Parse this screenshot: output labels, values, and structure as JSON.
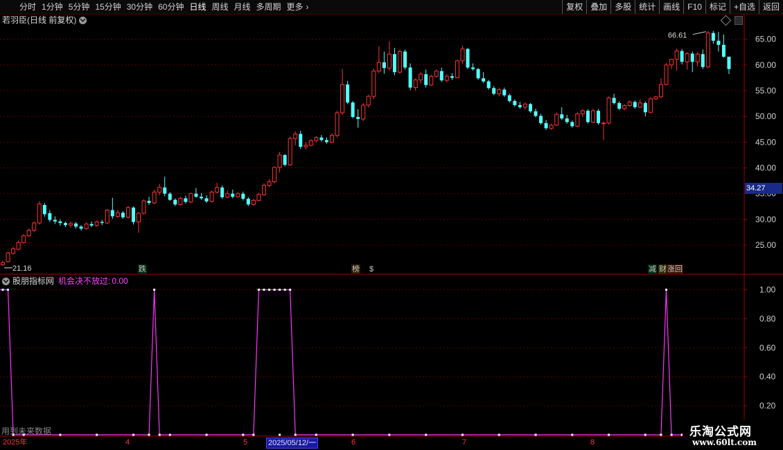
{
  "toolbar": {
    "periods": [
      "分时",
      "1分钟",
      "5分钟",
      "15分钟",
      "30分钟",
      "60分钟",
      "日线",
      "周线",
      "月线",
      "多周期",
      "更多"
    ],
    "active_period": "日线",
    "buttons": [
      "复权",
      "叠加",
      "多股",
      "统计",
      "画线",
      "F10",
      "标记",
      "+自选",
      "返回"
    ]
  },
  "main_panel": {
    "title": "若羽臣(日线 前复权)",
    "current_price_label": "34.27",
    "high_annotation": "66.61",
    "low_annotation": "21.16",
    "y_ticks": [
      "65.00",
      "60.00",
      "55.00",
      "50.00",
      "45.00",
      "40.00",
      "35.00",
      "30.00",
      "25.00"
    ],
    "signals": [
      {
        "text": "跌",
        "color": "#00d060"
      },
      {
        "text": "榜",
        "color": "#e0a000"
      },
      {
        "text": "$",
        "color": "#ff3030"
      },
      {
        "text": "减",
        "color": "#00d060"
      },
      {
        "text": "财",
        "color": "#e0e000"
      },
      {
        "text": "涨回",
        "color": "#ff4040"
      }
    ]
  },
  "sub_panel": {
    "source": "股朋指标网",
    "indicator": "机会决不放过:",
    "value": "0.00",
    "y_ticks": [
      "1.00",
      "0.80",
      "0.60",
      "0.40",
      "0.20"
    ]
  },
  "footnote": "用到未来数据",
  "date_axis": {
    "labels": [
      "2025年",
      "4",
      "5",
      "6",
      "7",
      "8"
    ],
    "selected": "2025/05/12/一"
  },
  "watermark": {
    "title": "乐淘公式网",
    "url": "www.60lt.com"
  },
  "chart_data": {
    "type": "candlestick",
    "up_color": "#ff3333",
    "down_color": "#54ffff",
    "ylim": [
      19.5,
      67.5
    ],
    "candles": [
      [
        21.2,
        22.0,
        21.0,
        21.6
      ],
      [
        21.8,
        23.7,
        21.6,
        23.5
      ],
      [
        23.4,
        24.7,
        23.2,
        24.3
      ],
      [
        24.2,
        25.9,
        24.0,
        25.5
      ],
      [
        25.5,
        27.1,
        25.3,
        26.8
      ],
      [
        26.8,
        28.2,
        26.6,
        27.9
      ],
      [
        27.9,
        29.6,
        27.5,
        29.3
      ],
      [
        29.3,
        33.5,
        29.0,
        33.0
      ],
      [
        32.8,
        33.2,
        30.5,
        31.0
      ],
      [
        31.2,
        31.8,
        29.5,
        29.9
      ],
      [
        29.9,
        30.6,
        29.1,
        29.6
      ],
      [
        29.6,
        30.0,
        28.8,
        29.3
      ],
      [
        29.3,
        29.6,
        28.5,
        28.9
      ],
      [
        28.9,
        29.6,
        28.4,
        29.2
      ],
      [
        29.2,
        29.5,
        28.2,
        28.6
      ],
      [
        28.6,
        28.9,
        27.8,
        28.2
      ],
      [
        28.2,
        29.4,
        28.0,
        29.1
      ],
      [
        29.1,
        29.6,
        28.5,
        28.8
      ],
      [
        28.8,
        29.8,
        28.6,
        29.5
      ],
      [
        29.5,
        29.9,
        28.9,
        29.3
      ],
      [
        29.3,
        32.0,
        29.1,
        31.8
      ],
      [
        31.8,
        34.2,
        30.1,
        30.6
      ],
      [
        30.6,
        31.9,
        30.3,
        31.3
      ],
      [
        31.3,
        31.6,
        30.1,
        30.4
      ],
      [
        30.4,
        32.6,
        30.2,
        32.3
      ],
      [
        32.3,
        32.5,
        29.0,
        29.5
      ],
      [
        29.5,
        31.4,
        27.4,
        31.2
      ],
      [
        31.2,
        33.9,
        30.9,
        33.6
      ],
      [
        33.6,
        34.4,
        32.8,
        33.2
      ],
      [
        33.2,
        35.8,
        33.0,
        35.3
      ],
      [
        35.3,
        36.9,
        34.7,
        36.2
      ],
      [
        36.2,
        38.3,
        34.5,
        35.0
      ],
      [
        35.0,
        35.3,
        33.6,
        33.8
      ],
      [
        33.8,
        34.1,
        32.6,
        32.9
      ],
      [
        32.9,
        34.4,
        32.7,
        34.1
      ],
      [
        34.1,
        34.6,
        33.1,
        33.4
      ],
      [
        33.4,
        35.2,
        33.2,
        35.0
      ],
      [
        35.0,
        36.1,
        34.2,
        34.4
      ],
      [
        34.4,
        35.1,
        33.8,
        34.1
      ],
      [
        34.1,
        34.7,
        33.2,
        33.5
      ],
      [
        33.5,
        35.6,
        33.3,
        35.3
      ],
      [
        35.3,
        37.1,
        35.0,
        36.2
      ],
      [
        36.2,
        36.6,
        34.0,
        34.3
      ],
      [
        34.3,
        35.6,
        34.1,
        35.0
      ],
      [
        35.0,
        35.8,
        34.1,
        34.4
      ],
      [
        34.4,
        35.3,
        34.2,
        35.0
      ],
      [
        35.0,
        35.4,
        33.7,
        34.0
      ],
      [
        34.0,
        34.3,
        32.6,
        32.9
      ],
      [
        32.9,
        34.0,
        32.7,
        33.7
      ],
      [
        33.7,
        35.2,
        33.5,
        34.8
      ],
      [
        34.8,
        37.0,
        34.6,
        36.6
      ],
      [
        36.6,
        37.8,
        36.2,
        37.3
      ],
      [
        37.3,
        40.3,
        37.0,
        40.1
      ],
      [
        40.1,
        43.1,
        39.1,
        42.5
      ],
      [
        42.5,
        42.7,
        40.3,
        40.6
      ],
      [
        40.6,
        46.1,
        40.4,
        45.7
      ],
      [
        45.7,
        47.1,
        44.4,
        46.6
      ],
      [
        46.6,
        47.2,
        43.7,
        44.1
      ],
      [
        44.1,
        45.0,
        43.6,
        44.4
      ],
      [
        44.4,
        45.6,
        44.2,
        45.3
      ],
      [
        45.3,
        46.2,
        44.9,
        45.9
      ],
      [
        45.9,
        46.4,
        45.1,
        45.4
      ],
      [
        45.4,
        45.9,
        44.7,
        45.0
      ],
      [
        45.0,
        46.7,
        44.8,
        46.3
      ],
      [
        46.3,
        51.1,
        45.9,
        50.7
      ],
      [
        50.7,
        59.2,
        50.3,
        56.2
      ],
      [
        56.2,
        56.9,
        52.4,
        52.7
      ],
      [
        52.7,
        53.0,
        49.6,
        49.9
      ],
      [
        49.9,
        51.4,
        47.8,
        49.5
      ],
      [
        49.5,
        52.6,
        49.1,
        52.2
      ],
      [
        52.2,
        54.2,
        51.7,
        53.9
      ],
      [
        53.9,
        59.3,
        53.4,
        58.8
      ],
      [
        58.8,
        63.6,
        58.4,
        60.5
      ],
      [
        60.5,
        62.6,
        58.3,
        59.4
      ],
      [
        59.4,
        64.6,
        58.9,
        62.1
      ],
      [
        62.1,
        63.3,
        58.0,
        58.6
      ],
      [
        58.6,
        63.0,
        58.3,
        62.6
      ],
      [
        62.6,
        63.0,
        59.1,
        59.5
      ],
      [
        59.5,
        60.3,
        55.1,
        55.6
      ],
      [
        55.6,
        57.4,
        55.0,
        57.1
      ],
      [
        57.1,
        58.6,
        56.4,
        58.2
      ],
      [
        58.2,
        59.1,
        55.6,
        56.1
      ],
      [
        56.1,
        58.1,
        55.9,
        57.8
      ],
      [
        57.8,
        59.1,
        57.5,
        58.8
      ],
      [
        58.8,
        59.5,
        56.7,
        57.0
      ],
      [
        57.0,
        58.2,
        56.6,
        57.8
      ],
      [
        57.8,
        58.4,
        57.1,
        57.5
      ],
      [
        57.5,
        61.0,
        57.4,
        60.8
      ],
      [
        60.8,
        63.7,
        60.2,
        63.1
      ],
      [
        63.1,
        63.3,
        59.2,
        59.5
      ],
      [
        59.5,
        60.3,
        58.9,
        59.2
      ],
      [
        59.2,
        59.4,
        57.1,
        57.4
      ],
      [
        57.4,
        58.6,
        56.5,
        56.8
      ],
      [
        56.8,
        57.1,
        55.2,
        55.5
      ],
      [
        55.5,
        55.9,
        54.1,
        54.4
      ],
      [
        54.4,
        55.6,
        53.9,
        55.2
      ],
      [
        55.2,
        55.6,
        53.8,
        54.1
      ],
      [
        54.1,
        54.4,
        52.7,
        53.0
      ],
      [
        53.0,
        53.3,
        51.9,
        52.2
      ],
      [
        52.2,
        52.8,
        51.5,
        51.8
      ],
      [
        51.8,
        52.7,
        51.3,
        52.4
      ],
      [
        52.4,
        52.6,
        50.7,
        51.0
      ],
      [
        51.0,
        51.5,
        49.8,
        50.1
      ],
      [
        50.1,
        50.5,
        48.4,
        48.7
      ],
      [
        48.7,
        49.3,
        47.4,
        47.7
      ],
      [
        47.7,
        48.6,
        47.4,
        48.3
      ],
      [
        48.3,
        50.8,
        48.1,
        50.4
      ],
      [
        50.4,
        51.8,
        49.3,
        49.6
      ],
      [
        49.6,
        50.3,
        48.6,
        48.9
      ],
      [
        48.9,
        49.2,
        47.8,
        48.1
      ],
      [
        48.1,
        50.8,
        47.9,
        50.5
      ],
      [
        50.5,
        51.4,
        49.9,
        51.1
      ],
      [
        51.1,
        51.4,
        48.6,
        48.9
      ],
      [
        48.9,
        51.5,
        48.7,
        51.1
      ],
      [
        51.1,
        51.4,
        48.4,
        48.7
      ],
      [
        48.7,
        49.0,
        45.4,
        48.7
      ],
      [
        48.7,
        53.9,
        48.4,
        53.6
      ],
      [
        53.6,
        54.4,
        52.3,
        52.6
      ],
      [
        52.6,
        52.9,
        51.2,
        51.5
      ],
      [
        51.5,
        52.4,
        51.2,
        52.1
      ],
      [
        52.1,
        53.1,
        51.9,
        52.8
      ],
      [
        52.8,
        53.1,
        51.5,
        51.8
      ],
      [
        51.8,
        53.3,
        51.6,
        52.6
      ],
      [
        52.6,
        52.9,
        50.0,
        50.8
      ],
      [
        50.8,
        53.8,
        50.6,
        53.4
      ],
      [
        53.4,
        54.0,
        53.2,
        53.8
      ],
      [
        53.8,
        57.4,
        53.6,
        56.2
      ],
      [
        56.2,
        60.4,
        56.0,
        60.0
      ],
      [
        60.0,
        60.6,
        59.2,
        61.1
      ],
      [
        61.1,
        63.2,
        58.9,
        62.7
      ],
      [
        62.7,
        63.1,
        60.1,
        60.6
      ],
      [
        60.6,
        62.5,
        59.1,
        62.2
      ],
      [
        62.2,
        62.6,
        58.6,
        60.6
      ],
      [
        60.6,
        62.5,
        59.7,
        62.1
      ],
      [
        62.1,
        63.0,
        59.2,
        59.6
      ],
      [
        59.6,
        66.6,
        59.4,
        66.2
      ],
      [
        66.2,
        66.6,
        64.1,
        64.7
      ],
      [
        64.7,
        66.4,
        62.6,
        63.9
      ],
      [
        63.9,
        65.9,
        61.4,
        61.6
      ],
      [
        61.6,
        60.8,
        58.2,
        59.2
      ]
    ],
    "indicator_series": {
      "name": "机会决不放过",
      "ylim": [
        0,
        1.05
      ],
      "spikes": [
        [
          0,
          1
        ],
        [
          1,
          1
        ],
        [
          2,
          0
        ],
        [
          28,
          0
        ],
        [
          29,
          1
        ],
        [
          30,
          0
        ],
        [
          48,
          0
        ],
        [
          49,
          1
        ],
        [
          50,
          1
        ],
        [
          51,
          1
        ],
        [
          52,
          1
        ],
        [
          53,
          1
        ],
        [
          54,
          1
        ],
        [
          55,
          1
        ],
        [
          56,
          0
        ],
        [
          126,
          0
        ],
        [
          127,
          1
        ],
        [
          128,
          0
        ],
        [
          141,
          0
        ]
      ]
    }
  }
}
